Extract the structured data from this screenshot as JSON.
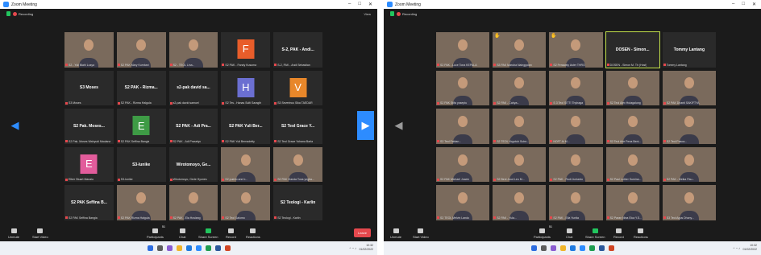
{
  "left": {
    "window_title": "Zoom Meeting",
    "recording": "Recording",
    "view": "View",
    "tiles": [
      {
        "kind": "video",
        "label": "S2 - Yuli Biahi Lusya"
      },
      {
        "kind": "video",
        "label": "S2 PAK Mary Kumbari"
      },
      {
        "kind": "video",
        "label": "S2 - TEOL Lina..."
      },
      {
        "kind": "avatar",
        "letter": "F",
        "color": "#e85d2a",
        "label": "S2 PAK - Fandy Kusuma"
      },
      {
        "kind": "name",
        "name": "S-2, PAK - Andi...",
        "label": "S-2, PAK - Andi Sebastian"
      },
      {
        "kind": "name",
        "name": "S3 Moses",
        "label": "S3 Moses"
      },
      {
        "kind": "name",
        "name": "S2 PAK - Rizma...",
        "label": "S2 PAK - Rizma Halgula"
      },
      {
        "kind": "name",
        "name": "s2-pak david sa...",
        "label": "s2-pak david samuel"
      },
      {
        "kind": "avatar",
        "letter": "H",
        "color": "#6b6fd1",
        "label": "S2 Tes - Hanas Sulti Saragih"
      },
      {
        "kind": "avatar",
        "letter": "V",
        "color": "#e8872a",
        "label": "S3 Severinus Sika TAEDAR"
      },
      {
        "kind": "name",
        "name": "S2 Pak. Moses...",
        "label": "S2 Pak. Moses Wahyudi Maulana"
      },
      {
        "kind": "avatar",
        "letter": "E",
        "color": "#3e9b45",
        "label": "S2 PAK Seffina Bangia"
      },
      {
        "kind": "name",
        "name": "S2 PAK - Adi Pra...",
        "label": "S2 PAK - Adi Prasetyo"
      },
      {
        "kind": "name",
        "name": "S2 PAK Yuli Ber...",
        "label": "S2 PAK Yuli Bernadetty"
      },
      {
        "kind": "name",
        "name": "S2 Teol Grace Y...",
        "label": "S2 Teol Grace Yohana Barla"
      },
      {
        "kind": "avatar",
        "letter": "E",
        "color": "#e25c9b",
        "label": "Elber Stuart Manalu"
      },
      {
        "kind": "name",
        "name": "S3-Iunike",
        "label": "S3-Iunike"
      },
      {
        "kind": "name",
        "name": "Wirotomoyo, Ge...",
        "label": "Wirotomoyo, Gede Hyones"
      },
      {
        "kind": "video",
        "label": "S2 puerto ane b..."
      },
      {
        "kind": "video",
        "label": "S2 PAK Vianda Tona yngba..."
      },
      {
        "kind": "name",
        "name": "S2 PAK Seffina B...",
        "label": "S2 PAK Seffina Bangia"
      },
      {
        "kind": "video",
        "label": "S2 PAK Rizma Halgula"
      },
      {
        "kind": "video",
        "label": "S2 PAK - Ela Hosiang"
      },
      {
        "kind": "video",
        "label": "S2 Teol Salomo"
      },
      {
        "kind": "name",
        "name": "S2 Teologi - Karlin",
        "label": "S2 Teologi - Karlin"
      }
    ],
    "toolbar": {
      "unmute": "Unmute",
      "start_video": "Start Video",
      "participants": "Participants",
      "participants_count": "51",
      "chat": "Chat",
      "share_screen": "Share Screen",
      "record": "Record",
      "reactions": "Reactions",
      "end": "Leave"
    },
    "clock_time": "10:32",
    "clock_date": "01/02/2022"
  },
  "right": {
    "window_title": "Zoom Meeting",
    "recording": "Recording",
    "tiles": [
      {
        "kind": "video",
        "label": "S2 PAK - Luce Tona KEPALA"
      },
      {
        "kind": "video",
        "hand": true,
        "label": "S3 PAK Maruba Nainggolan"
      },
      {
        "kind": "video",
        "hand": true,
        "label": "S2 Ferawaty Aster THRO"
      },
      {
        "kind": "name",
        "name": "DOSEN - Simon...",
        "active": true,
        "label": "DOSEN - Simon M. Th (Host)"
      },
      {
        "kind": "name",
        "name": "Tommy Lantang",
        "label": "Tommy Lantang"
      },
      {
        "kind": "video",
        "label": "S2 PAK Stifa yosepiu"
      },
      {
        "kind": "video",
        "label": "S2 PAK - Cahya..."
      },
      {
        "kind": "video",
        "label": "S 3 Teol SITTI Thyhaga"
      },
      {
        "kind": "video",
        "label": "S2 Teol Alex Hutagalung"
      },
      {
        "kind": "video",
        "label": "S2 PAK Dhanti SAKIFTYA"
      },
      {
        "kind": "video",
        "label": "S2 Teol Fabian..."
      },
      {
        "kind": "video",
        "label": "S2 TEOL Yogotuh Suhe..."
      },
      {
        "kind": "video",
        "label": "NOFT Ai M..."
      },
      {
        "kind": "video",
        "label": "S2 Teol Arie Pena Beni..."
      },
      {
        "kind": "video",
        "label": "S2 Teol Pasoa..."
      },
      {
        "kind": "video",
        "label": "S2 PAK Michael Juwen"
      },
      {
        "kind": "video",
        "label": "S2 Beni Joud Leo M..."
      },
      {
        "kind": "video",
        "label": "S2 PAK - Rudi Junianto"
      },
      {
        "kind": "video",
        "label": "S2 Paul Luther Sumina..."
      },
      {
        "kind": "video",
        "label": "S2 PAK - Meika Pau..."
      },
      {
        "kind": "video",
        "label": "S2 TEOL Melvin Lando"
      },
      {
        "kind": "video",
        "label": "S2 PAK - Yula..."
      },
      {
        "kind": "video",
        "label": "S2 PAK - Elia Yunita"
      },
      {
        "kind": "video",
        "label": "S2 Paran Nina Elca Y.S..."
      },
      {
        "kind": "video",
        "label": "S3 Teol Agus Dhony..."
      }
    ],
    "toolbar": {
      "unmute": "Unmute",
      "start_video": "Start Video",
      "participants": "Participants",
      "participants_count": "51",
      "chat": "Chat",
      "share_screen": "Share Screen",
      "record": "Record",
      "reactions": "Reactions"
    },
    "clock_time": "10:32",
    "clock_date": "01/02/2022"
  }
}
